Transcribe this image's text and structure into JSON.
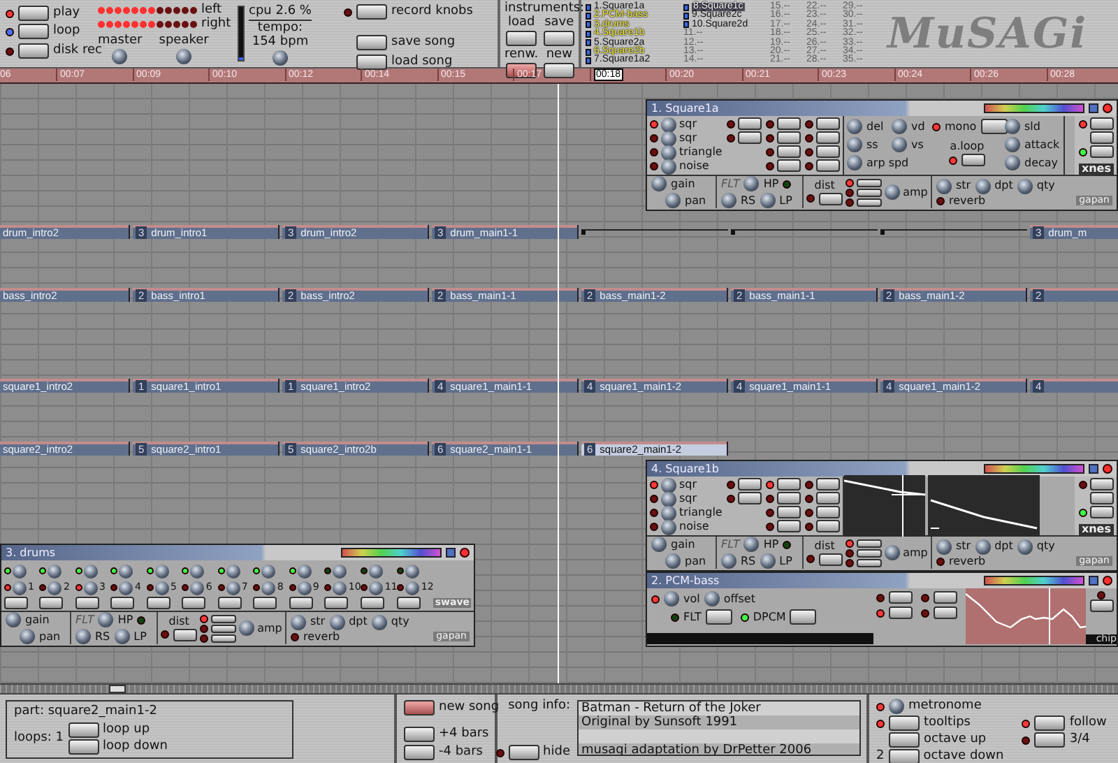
{
  "transport": [
    {
      "label": "play",
      "lit": true,
      "kind": "red"
    },
    {
      "label": "loop",
      "lit": true,
      "kind": "blue"
    },
    {
      "label": "disk rec",
      "lit": false,
      "kind": "red"
    }
  ],
  "meters": [
    {
      "label": "left",
      "level": 0.58
    },
    {
      "label": "right",
      "level": 0.58
    }
  ],
  "knobs": [
    "master",
    "speaker"
  ],
  "cpu": {
    "label": "cpu 2.6 %",
    "level": 0.06
  },
  "tempo": {
    "label": "tempo:",
    "value": "154 bpm"
  },
  "song_buttons": [
    {
      "label": "record knobs",
      "lit": false
    },
    {
      "label": "save song"
    },
    {
      "label": "load song"
    }
  ],
  "instruments": {
    "title": "instruments:",
    "buttons": [
      {
        "label": "load",
        "active": false
      },
      {
        "label": "save",
        "active": false
      },
      {
        "label": "renw.",
        "active": true
      },
      {
        "label": "new",
        "active": false
      }
    ],
    "list": [
      {
        "label": "1.Square1a",
        "kind": "instrument",
        "playing": false,
        "selected": false
      },
      {
        "label": "2.PCM-bass",
        "kind": "instrument",
        "playing": true,
        "selected": false
      },
      {
        "label": "3.drums",
        "kind": "instrument",
        "playing": true,
        "selected": false
      },
      {
        "label": "4.Square1b",
        "kind": "instrument",
        "playing": true,
        "selected": false
      },
      {
        "label": "5.Square2a",
        "kind": "instrument",
        "playing": false,
        "selected": false
      },
      {
        "label": "6.Square2b",
        "kind": "instrument",
        "playing": true,
        "selected": false
      },
      {
        "label": "7.Square1a2",
        "kind": "instrument",
        "playing": false,
        "selected": false
      },
      {
        "label": "8.Square1c",
        "kind": "instrument",
        "playing": false,
        "selected": true
      },
      {
        "label": "9.Square2c",
        "kind": "instrument",
        "playing": false,
        "selected": false
      },
      {
        "label": "10.Square2d",
        "kind": "instrument",
        "playing": false,
        "selected": false
      },
      {
        "label": "11.--",
        "kind": "empty",
        "playing": false,
        "selected": false
      },
      {
        "label": "12.--",
        "kind": "empty",
        "playing": false,
        "selected": false
      },
      {
        "label": "13.--",
        "kind": "empty",
        "playing": false,
        "selected": false
      },
      {
        "label": "14.--",
        "kind": "empty",
        "playing": false,
        "selected": false
      },
      {
        "label": "15.--",
        "kind": "empty",
        "playing": false,
        "selected": false
      },
      {
        "label": "16.--",
        "kind": "empty",
        "playing": false,
        "selected": false
      },
      {
        "label": "17.--",
        "kind": "empty",
        "playing": false,
        "selected": false
      },
      {
        "label": "18.--",
        "kind": "empty",
        "playing": false,
        "selected": false
      },
      {
        "label": "19.--",
        "kind": "empty",
        "playing": false,
        "selected": false
      },
      {
        "label": "20.--",
        "kind": "empty",
        "playing": false,
        "selected": false
      },
      {
        "label": "21.--",
        "kind": "empty",
        "playing": false,
        "selected": false
      },
      {
        "label": "22.--",
        "kind": "empty",
        "playing": false,
        "selected": false
      },
      {
        "label": "23.--",
        "kind": "empty",
        "playing": false,
        "selected": false
      },
      {
        "label": "24.--",
        "kind": "empty",
        "playing": false,
        "selected": false
      },
      {
        "label": "25.--",
        "kind": "empty",
        "playing": false,
        "selected": false
      },
      {
        "label": "26.--",
        "kind": "empty",
        "playing": false,
        "selected": false
      },
      {
        "label": "27.--",
        "kind": "empty",
        "playing": false,
        "selected": false
      },
      {
        "label": "28.--",
        "kind": "empty",
        "playing": false,
        "selected": false
      },
      {
        "label": "29.--",
        "kind": "empty",
        "playing": false,
        "selected": false
      },
      {
        "label": "30.--",
        "kind": "empty",
        "playing": false,
        "selected": false
      },
      {
        "label": "31.--",
        "kind": "empty",
        "playing": false,
        "selected": false
      },
      {
        "label": "32.--",
        "kind": "empty",
        "playing": false,
        "selected": false
      },
      {
        "label": "33.--",
        "kind": "empty",
        "playing": false,
        "selected": false
      },
      {
        "label": "34.--",
        "kind": "empty",
        "playing": false,
        "selected": false
      },
      {
        "label": "35.--",
        "kind": "empty",
        "playing": false,
        "selected": false
      }
    ]
  },
  "logo": "MuSAGi",
  "ruler": [
    {
      "label": "06",
      "selected": false
    },
    {
      "label": "00:07",
      "selected": false
    },
    {
      "label": "00:09",
      "selected": false
    },
    {
      "label": "00:10",
      "selected": false
    },
    {
      "label": "00:12",
      "selected": false
    },
    {
      "label": "00:14",
      "selected": false
    },
    {
      "label": "00:15",
      "selected": false
    },
    {
      "label": "00:17",
      "selected": false
    },
    {
      "label": "00:18",
      "selected": true
    },
    {
      "label": "00:20",
      "selected": false
    },
    {
      "label": "00:21",
      "selected": false
    },
    {
      "label": "00:23",
      "selected": false
    },
    {
      "label": "00:24",
      "selected": false
    },
    {
      "label": "00:26",
      "selected": false
    },
    {
      "label": "00:28",
      "selected": false
    }
  ],
  "tracks": [
    {
      "parts": [
        {
          "kind": "part",
          "name": "drum_intro2",
          "selected": false
        },
        {
          "kind": "part",
          "number": "3",
          "name": "drum_intro1",
          "selected": false
        },
        {
          "kind": "part",
          "number": "3",
          "name": "drum_intro2",
          "selected": false
        },
        {
          "kind": "part",
          "number": "3",
          "name": "drum_main1-1",
          "selected": false
        },
        {
          "kind": "blank"
        },
        {
          "kind": "blank"
        },
        {
          "kind": "blank"
        },
        {
          "kind": "part",
          "number": "3",
          "name": "drum_m",
          "selected": false
        }
      ]
    },
    {
      "parts": [
        {
          "kind": "part",
          "name": "bass_intro2",
          "selected": false
        },
        {
          "kind": "part",
          "number": "2",
          "name": "bass_intro1",
          "selected": false
        },
        {
          "kind": "part",
          "number": "2",
          "name": "bass_intro2",
          "selected": false
        },
        {
          "kind": "part",
          "number": "2",
          "name": "bass_main1-1",
          "selected": false
        },
        {
          "kind": "part",
          "number": "2",
          "name": "bass_main1-2",
          "selected": false
        },
        {
          "kind": "part",
          "number": "2",
          "name": "bass_main1-1",
          "selected": false
        },
        {
          "kind": "part",
          "number": "2",
          "name": "bass_main1-2",
          "selected": false
        },
        {
          "kind": "part",
          "number": "2",
          "selected": false
        }
      ]
    },
    {
      "parts": [
        {
          "kind": "part",
          "name": "square1_intro2",
          "selected": false
        },
        {
          "kind": "part",
          "number": "1",
          "name": "square1_intro1",
          "selected": false
        },
        {
          "kind": "part",
          "number": "1",
          "name": "square1_intro2",
          "selected": false
        },
        {
          "kind": "part",
          "number": "4",
          "name": "square1_main1-1",
          "selected": false
        },
        {
          "kind": "part",
          "number": "4",
          "name": "square1_main1-2",
          "selected": false
        },
        {
          "kind": "part",
          "number": "4",
          "name": "square1_main1-1",
          "selected": false
        },
        {
          "kind": "part",
          "number": "4",
          "name": "square1_main1-2",
          "selected": false
        },
        {
          "kind": "part",
          "number": "4",
          "selected": false
        }
      ]
    },
    {
      "parts": [
        {
          "kind": "part",
          "name": "square2_intro2",
          "selected": false
        },
        {
          "kind": "part",
          "number": "5",
          "name": "square2_intro1",
          "selected": false
        },
        {
          "kind": "part",
          "number": "5",
          "name": "square2_intro2b",
          "selected": false
        },
        {
          "kind": "part",
          "number": "6",
          "name": "square2_main1-1",
          "selected": false
        },
        {
          "kind": "part",
          "number": "6",
          "name": "square2_main1-2",
          "selected": true
        }
      ]
    }
  ],
  "windows": [
    {
      "kind": "synth",
      "title": "1. Square1a",
      "oscillators": [
        {
          "label": "sqr",
          "on": true
        },
        {
          "label": "sqr",
          "on": false
        },
        {
          "label": "triangle",
          "on": false
        },
        {
          "label": "noise",
          "on": false
        }
      ],
      "switches": [
        [
          false,
          false
        ],
        [
          false,
          false,
          false,
          false
        ],
        [
          false,
          false,
          false,
          false
        ]
      ],
      "params": [
        {
          "kind": "knob",
          "label": "del"
        },
        {
          "kind": "knob",
          "label": "vd"
        },
        {
          "kind": "switch",
          "label": "mono",
          "on": true
        },
        {
          "kind": "knob",
          "label": "sld"
        },
        {
          "kind": "knob",
          "label": "ss"
        },
        {
          "kind": "knob",
          "label": "vs"
        },
        {
          "kind": "switch-under",
          "label": "a.loop",
          "on": true
        },
        {
          "kind": "knob",
          "label": "attack"
        },
        {
          "kind": "wide-knob",
          "label": "arp spd"
        },
        {
          "kind": "knob",
          "label": "decay"
        }
      ],
      "side": {
        "label": "xnes",
        "top_on": true,
        "bottom_on": true
      },
      "effects": {
        "knobs": [
          "gain",
          "pan",
          "HP",
          "RS",
          "LP",
          "amp",
          "str",
          "dpt",
          "qty"
        ],
        "filter": {
          "label": "FLT",
          "enabled": false
        },
        "filter_led": false,
        "dist": {
          "label": "dist",
          "on": false
        },
        "dist_modes": [
          true,
          false,
          false
        ],
        "reverb": {
          "label": "reverb",
          "on": false
        },
        "badge": "gapan"
      }
    },
    {
      "kind": "synth-envelope",
      "title": "4. Square1b",
      "oscillators": [
        {
          "label": "sqr",
          "on": true
        },
        {
          "label": "sqr",
          "on": false
        },
        {
          "label": "triangle",
          "on": false
        },
        {
          "label": "noise",
          "on": false
        }
      ],
      "switches": [
        [
          false,
          false
        ],
        [
          true,
          false,
          false,
          false
        ],
        [
          false,
          false,
          false,
          false
        ]
      ],
      "side": {
        "label": "xnes",
        "top_on": false,
        "bottom_on": true
      },
      "effects": {
        "knobs": [
          "gain",
          "pan",
          "HP",
          "RS",
          "LP",
          "amp",
          "str",
          "dpt",
          "qty"
        ],
        "filter": {
          "label": "FLT",
          "enabled": false
        },
        "filter_led": false,
        "dist": {
          "label": "dist",
          "on": false
        },
        "dist_modes": [
          true,
          false,
          false
        ],
        "reverb": {
          "label": "reverb",
          "on": false
        },
        "badge": "gapan"
      }
    },
    {
      "kind": "drums",
      "title": "3. drums",
      "pads": [
        {
          "label": "1",
          "on": true,
          "accent": true
        },
        {
          "label": "2",
          "on": true,
          "accent": false
        },
        {
          "label": "3",
          "on": true,
          "accent": true
        },
        {
          "label": "4",
          "on": true,
          "accent": false
        },
        {
          "label": "5",
          "on": true,
          "accent": false
        },
        {
          "label": "6",
          "on": true,
          "accent": false
        },
        {
          "label": "7",
          "on": true,
          "accent": false
        },
        {
          "label": "8",
          "on": true,
          "accent": false
        },
        {
          "label": "9",
          "on": true,
          "accent": false
        },
        {
          "label": "10",
          "on": false,
          "accent": false
        },
        {
          "label": "11",
          "on": false,
          "accent": false
        },
        {
          "label": "12",
          "on": false,
          "accent": false
        }
      ],
      "badge": "swave",
      "effects": {
        "knobs": [
          "gain",
          "pan",
          "HP",
          "RS",
          "LP",
          "amp",
          "str",
          "dpt",
          "qty"
        ],
        "filter": {
          "label": "FLT",
          "enabled": false
        },
        "filter_led": false,
        "dist": {
          "label": "dist",
          "on": false
        },
        "dist_modes": [
          true,
          false,
          false
        ],
        "reverb": {
          "label": "reverb",
          "on": false
        },
        "badge": "gapan"
      }
    },
    {
      "kind": "pcm",
      "title": "2. PCM-bass",
      "power": true,
      "knobs": [
        "vol",
        "offset"
      ],
      "buttons": [
        {
          "on": false
        },
        {
          "on": false
        },
        {
          "on": true
        },
        {
          "on": false
        }
      ],
      "switches": [
        {
          "label": "FLT",
          "on": false
        },
        {
          "label": "DPCM",
          "on": true
        }
      ],
      "side_on": false,
      "badge": "chip"
    }
  ],
  "bottom": {
    "part": {
      "label": "part: square2_main1-2",
      "loops": "loops: 1",
      "buttons": [
        "loop up",
        "loop down"
      ]
    },
    "song": {
      "new_song": "new song",
      "buttons": [
        "+4 bars",
        "-4 bars"
      ]
    },
    "song_info": {
      "label": "song info:",
      "lines": [
        {
          "kind": "text",
          "text": "Batman - Return of the Joker"
        },
        {
          "kind": "text",
          "text": "Original by Sunsoft 1991"
        },
        {
          "kind": "blank"
        },
        {
          "kind": "text",
          "text": "musagi adaptation by DrPetter 2006"
        }
      ],
      "hide": {
        "label": "hide",
        "lit": false
      }
    },
    "options": {
      "metronome": {
        "label": "metronome",
        "lit": true
      },
      "tooltips": {
        "label": "tooltips",
        "lit": true
      },
      "octave_up": "octave up",
      "octave": "2",
      "octave_down": "octave down",
      "follow": {
        "label": "follow",
        "lit": true
      },
      "meter": {
        "label": "3/4",
        "lit": false
      }
    }
  }
}
